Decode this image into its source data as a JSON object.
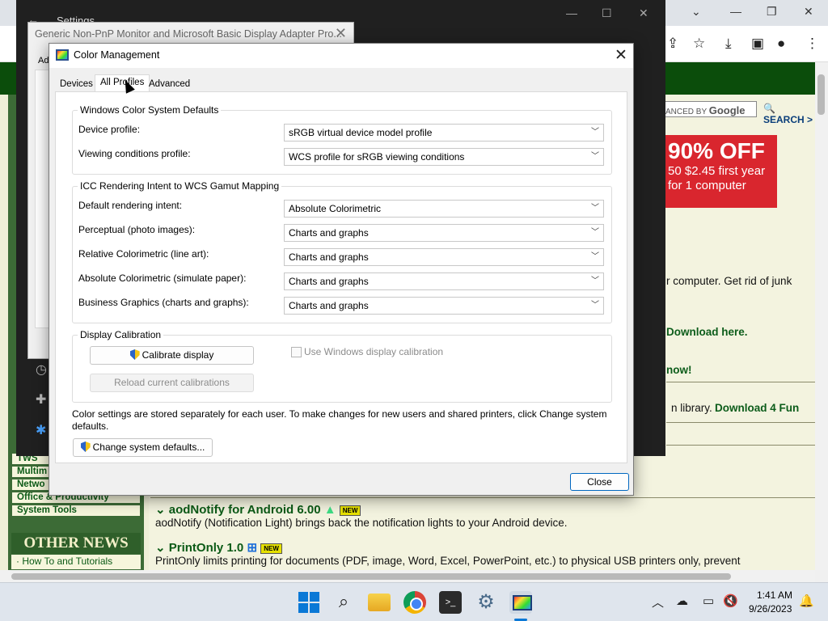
{
  "settings_window": {
    "title": "Settings"
  },
  "monitor_window": {
    "title": "Generic Non-PnP Monitor and Microsoft Basic Display Adapter Pro...",
    "tab_partial": "Ad"
  },
  "color_management": {
    "title": "Color Management",
    "tabs": [
      {
        "label": "Devices",
        "active": false
      },
      {
        "label": "All Profiles",
        "active": true
      },
      {
        "label": "Advanced",
        "active": false
      }
    ],
    "wcs_defaults": {
      "heading": "Windows Color System Defaults",
      "rows": [
        {
          "label": "Device profile:",
          "value": "sRGB virtual device model profile"
        },
        {
          "label": "Viewing conditions profile:",
          "value": "WCS profile for sRGB viewing conditions"
        }
      ]
    },
    "icc_mapping": {
      "heading": "ICC Rendering Intent to WCS Gamut Mapping",
      "rows": [
        {
          "label": "Default rendering intent:",
          "value": "Absolute Colorimetric"
        },
        {
          "label": "Perceptual (photo images):",
          "value": "Charts and graphs"
        },
        {
          "label": "Relative Colorimetric (line art):",
          "value": "Charts and graphs"
        },
        {
          "label": "Absolute Colorimetric (simulate paper):",
          "value": "Charts and graphs"
        },
        {
          "label": "Business Graphics (charts and graphs):",
          "value": "Charts and graphs"
        }
      ]
    },
    "calibration": {
      "heading": "Display Calibration",
      "calibrate_button": "Calibrate display",
      "reload_button": "Reload current calibrations",
      "checkbox_label": "Use Windows display calibration",
      "checkbox_checked": false
    },
    "info_text": "Color settings are stored separately for each user. To make changes for new users and shared printers, click Change system defaults.",
    "change_defaults_button": "Change system defaults...",
    "close_button": "Close"
  },
  "webpage": {
    "google_box": {
      "prefix": "ANCED BY",
      "brand": "Google"
    },
    "search_link": "SEARCH >",
    "ad": {
      "headline": "90% OFF",
      "price_line": "50 $2.45 first year",
      "sub_line": "for 1 computer"
    },
    "snippets": [
      "r computer. Get rid of junk",
      "Download here.",
      "now!",
      "n library.",
      "Download 4 Fun"
    ],
    "categories": [
      "TWS",
      "Multim",
      "Netwo",
      "Office & Productivity",
      "System Tools"
    ],
    "other_news": "OTHER NEWS",
    "howto": "· How To and Tutorials",
    "news": [
      {
        "title": "aodNotify for Android 6.00",
        "badge": "NEW",
        "desc": "aodNotify (Notification Light) brings back the notification lights to your Android device."
      },
      {
        "title": "PrintOnly 1.0",
        "badge": "NEW",
        "desc": "PrintOnly limits printing for documents (PDF, image, Word, Excel, PowerPoint, etc.) to physical USB printers only, prevent"
      }
    ]
  },
  "taskbar": {
    "time": "1:41 AM",
    "date": "9/26/2023",
    "terminal_glyph": ">_"
  },
  "colors": {
    "accent": "#0067c0",
    "web_green": "#0b5a16",
    "ad_red": "#d9262e"
  }
}
